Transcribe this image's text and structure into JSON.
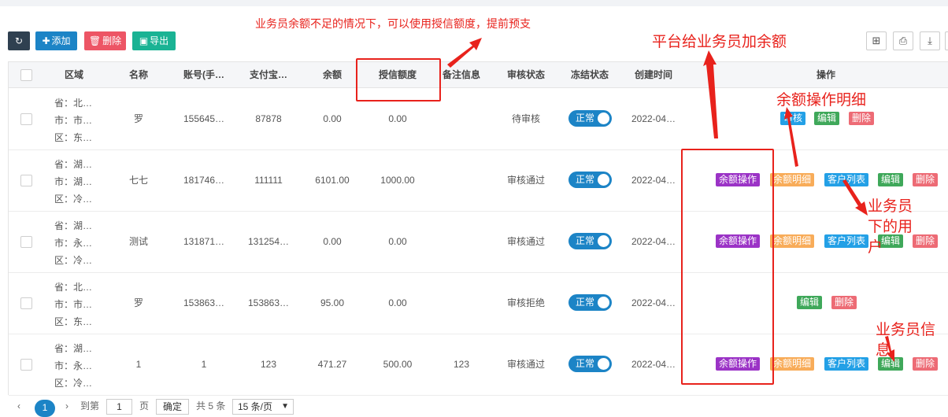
{
  "toolbar": {
    "refresh_icon": "refresh-icon",
    "add_label": "添加",
    "delete_label": "删除",
    "export_label": "导出"
  },
  "colors": {
    "accent": "#1c84c6",
    "danger": "#ed5565",
    "success": "#1ab394",
    "annotation": "#e8221c"
  },
  "table": {
    "headers": [
      "区域",
      "名称",
      "账号(手…",
      "支付宝…",
      "余额",
      "授信额度",
      "备注信息",
      "审核状态",
      "冻结状态",
      "创建时间",
      "操作"
    ],
    "rows": [
      {
        "region": [
          "省：北…",
          "市：市…",
          "区：东…"
        ],
        "name": "罗",
        "account": "155645…",
        "alipay": "87878",
        "balance": "0.00",
        "credit": "0.00",
        "note": "",
        "audit": "待审核",
        "freeze": "正常",
        "created": "2022-04…",
        "ops": [
          "审核",
          "编辑",
          "删除"
        ]
      },
      {
        "region": [
          "省：湖…",
          "市：湖…",
          "区：冷…"
        ],
        "name": "七七",
        "account": "181746…",
        "alipay": "111111",
        "balance": "6101.00",
        "credit": "1000.00",
        "note": "",
        "audit": "审核通过",
        "freeze": "正常",
        "created": "2022-04…",
        "ops": [
          "余额操作",
          "余额明细",
          "客户列表",
          "编辑",
          "删除"
        ]
      },
      {
        "region": [
          "省：湖…",
          "市：永…",
          "区：冷…"
        ],
        "name": "测试",
        "account": "131871…",
        "alipay": "131254…",
        "balance": "0.00",
        "credit": "0.00",
        "note": "",
        "audit": "审核通过",
        "freeze": "正常",
        "created": "2022-04…",
        "ops": [
          "余额操作",
          "余额明细",
          "客户列表",
          "编辑",
          "删除"
        ]
      },
      {
        "region": [
          "省：北…",
          "市：市…",
          "区：东…"
        ],
        "name": "罗",
        "account": "153863…",
        "alipay": "153863…",
        "balance": "95.00",
        "credit": "0.00",
        "note": "",
        "audit": "审核拒绝",
        "freeze": "正常",
        "created": "2022-04…",
        "ops": [
          "编辑",
          "删除"
        ]
      },
      {
        "region": [
          "省：湖…",
          "市：永…",
          "区：冷…"
        ],
        "name": "1",
        "account": "1",
        "alipay": "123",
        "balance": "471.27",
        "credit": "500.00",
        "note": "123",
        "audit": "审核通过",
        "freeze": "正常",
        "created": "2022-04…",
        "ops": [
          "余额操作",
          "余额明细",
          "客户列表",
          "编辑",
          "删除"
        ]
      }
    ]
  },
  "pager": {
    "current": "1",
    "goto_label": "到第",
    "page_input": "1",
    "page_unit": "页",
    "confirm": "确定",
    "total": "共 5 条",
    "page_size": "15 条/页"
  },
  "annotations": {
    "credit_note": "业务员余额不足的情况下，可以使用授信额度，提前预支",
    "platform_note": "平台给业务员加余额",
    "detail_note": "余额操作明细",
    "customer_note_1": "业务员",
    "customer_note_2": "下的用",
    "customer_note_3": "户",
    "info_note_1": "业务员信",
    "info_note_2": "息"
  }
}
